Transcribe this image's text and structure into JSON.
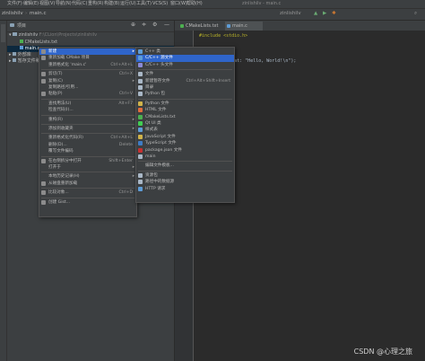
{
  "titlebar": {
    "menus": [
      "文件(F)",
      "编辑(E)",
      "视图(V)",
      "导航(N)",
      "代码(C)",
      "重构(R)",
      "构建(B)",
      "运行(U)",
      "工具(T)",
      "VCS(S)",
      "窗口(W)",
      "帮助(H)"
    ],
    "window_title": "zinlishilv - main.c"
  },
  "navbar": {
    "crumbs": [
      "zinlishilv",
      "main.c"
    ],
    "run_config": "zinlishilv"
  },
  "project_panel": {
    "title": "项目",
    "root": "zinlishilv",
    "root_path": "F:\\CLion\\Projects\\zinlishilv",
    "items": [
      "CMakeLists.txt",
      "main.c"
    ],
    "external": "外部库",
    "scratch": "暂存文件和控制台"
  },
  "editor": {
    "tabs": [
      "CMakeLists.txt",
      "main.c"
    ],
    "lines": [
      "#include <stdio.h>",
      "",
      "",
      "",
      "    printf( _Format: \"Hello, World!\\n\");"
    ]
  },
  "context_menu": {
    "items": [
      {
        "label": "新建",
        "shortcut": "",
        "arrow": true,
        "highlight": true,
        "icon": "new-icon"
      },
      {
        "label": "重新加载 CMake 项目",
        "shortcut": "",
        "icon": "cmake-icon"
      },
      {
        "label": "重新格式化 'main.c'",
        "shortcut": "Ctrl+Alt+L",
        "icon": ""
      },
      {
        "sep": true
      },
      {
        "label": "剪切(T)",
        "shortcut": "Ctrl+X",
        "icon": "cut-icon"
      },
      {
        "label": "复制(C)",
        "shortcut": "",
        "arrow": true,
        "icon": "copy-icon"
      },
      {
        "label": "复制路径/引用...",
        "shortcut": "",
        "icon": ""
      },
      {
        "label": "粘贴(P)",
        "shortcut": "Ctrl+V",
        "icon": "paste-icon"
      },
      {
        "sep": true
      },
      {
        "label": "查找用法(U)",
        "shortcut": "Alt+F7",
        "icon": ""
      },
      {
        "label": "检查代码(I)...",
        "shortcut": "",
        "icon": ""
      },
      {
        "sep": true
      },
      {
        "label": "重构(R)",
        "shortcut": "",
        "arrow": true,
        "icon": ""
      },
      {
        "sep": true
      },
      {
        "label": "添加到收藏夹",
        "shortcut": "",
        "arrow": true,
        "icon": ""
      },
      {
        "sep": true
      },
      {
        "label": "重新格式化代码(R)",
        "shortcut": "Ctrl+Alt+L",
        "icon": ""
      },
      {
        "label": "删除(D)...",
        "shortcut": "Delete",
        "icon": ""
      },
      {
        "label": "覆写文件编码",
        "shortcut": "",
        "icon": ""
      },
      {
        "sep": true
      },
      {
        "label": "在右侧拆分中打开",
        "shortcut": "Shift+Enter",
        "icon": "split-icon"
      },
      {
        "label": "打开于",
        "shortcut": "",
        "arrow": true,
        "icon": ""
      },
      {
        "sep": true
      },
      {
        "label": "本地历史记录(H)",
        "shortcut": "",
        "arrow": true,
        "icon": ""
      },
      {
        "label": "从磁盘重新加载",
        "shortcut": "",
        "icon": "reload-icon"
      },
      {
        "sep": true
      },
      {
        "label": "比较对象...",
        "shortcut": "Ctrl+D",
        "icon": "compare-icon"
      },
      {
        "sep": true
      },
      {
        "label": "创建 Gist...",
        "shortcut": "",
        "icon": "github-icon"
      }
    ]
  },
  "submenu": {
    "items": [
      {
        "label": "C++ 类",
        "shortcut": "",
        "icon": "cpp-class-icon",
        "color": "#5e9cd6"
      },
      {
        "label": "C/C++ 源文件",
        "shortcut": "",
        "highlight": true,
        "icon": "c-source-icon",
        "color": "#5e9cd6"
      },
      {
        "label": "C/C++ 头文件",
        "shortcut": "",
        "icon": "c-header-icon",
        "color": "#8a8ad6"
      },
      {
        "sep": true
      },
      {
        "label": "文件",
        "shortcut": "",
        "icon": "file-icon",
        "color": "#a9b7c6"
      },
      {
        "label": "新建暂存文件",
        "shortcut": "Ctrl+Alt+Shift+Insert",
        "icon": "scratch-icon",
        "color": "#a9b7c6"
      },
      {
        "label": "目录",
        "shortcut": "",
        "icon": "folder-icon",
        "color": "#a9b7c6"
      },
      {
        "label": "Python 包",
        "shortcut": "",
        "icon": "python-package-icon",
        "color": "#a9b7c6"
      },
      {
        "sep": true
      },
      {
        "label": "Python 文件",
        "shortcut": "",
        "icon": "python-icon",
        "color": "#d0b34a"
      },
      {
        "label": "HTML 文件",
        "shortcut": "",
        "icon": "html-icon",
        "color": "#e06c3c"
      },
      {
        "label": "CMakeLists.txt",
        "shortcut": "",
        "icon": "cmake-icon",
        "color": "#4caf50"
      },
      {
        "label": "Qt UI 类",
        "shortcut": "",
        "icon": "qt-icon",
        "color": "#41cd52"
      },
      {
        "label": "样式表",
        "shortcut": "",
        "icon": "stylesheet-icon",
        "color": "#5e9cd6"
      },
      {
        "label": "JavaScript 文件",
        "shortcut": "",
        "icon": "javascript-icon",
        "color": "#d0b34a"
      },
      {
        "label": "TypeScript 文件",
        "shortcut": "",
        "icon": "typescript-icon",
        "color": "#3f7cc4"
      },
      {
        "label": "package.json 文件",
        "shortcut": "",
        "icon": "npm-icon",
        "color": "#c53030"
      },
      {
        "label": "main",
        "shortcut": "",
        "icon": "main-icon",
        "color": "#a9b7c6"
      },
      {
        "sep": true
      },
      {
        "label": "编辑文件模板...",
        "shortcut": "",
        "icon": "",
        "color": ""
      },
      {
        "sep": true
      },
      {
        "label": "资源包",
        "shortcut": "",
        "icon": "resource-icon",
        "color": "#a9b7c6"
      },
      {
        "label": "路径中的数据源",
        "shortcut": "",
        "icon": "datasource-icon",
        "color": "#a9b7c6"
      },
      {
        "label": "HTTP 请求",
        "shortcut": "",
        "icon": "http-icon",
        "color": "#5e9cd6"
      }
    ]
  },
  "watermark": "CSDN @心理之旅"
}
